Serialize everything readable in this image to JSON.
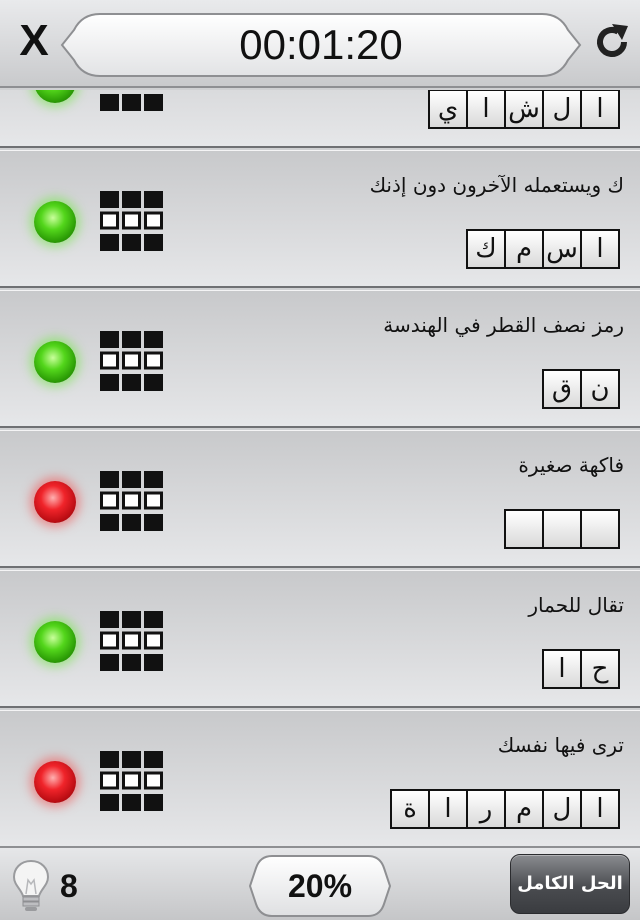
{
  "header": {
    "close_label": "X",
    "timer": "00:01:20"
  },
  "rows": [
    {
      "clue": "",
      "answer": [
        "ا",
        "ل",
        "ش",
        "ا",
        "ي"
      ],
      "status": "green"
    },
    {
      "clue": "ك ويستعمله الآخرون دون إذنك",
      "answer": [
        "ا",
        "س",
        "م",
        "ك"
      ],
      "status": "green"
    },
    {
      "clue": "رمز نصف القطر في الهندسة",
      "answer": [
        "ن",
        "ق"
      ],
      "status": "green"
    },
    {
      "clue": "فاكهة صغيرة",
      "answer": [
        "",
        "",
        ""
      ],
      "status": "red"
    },
    {
      "clue": "تقال للحمار",
      "answer": [
        "ح",
        "ا"
      ],
      "status": "green"
    },
    {
      "clue": "ترى فيها نفسك",
      "answer": [
        "ا",
        "ل",
        "م",
        "ر",
        "ا",
        "ة"
      ],
      "status": "red"
    }
  ],
  "footer": {
    "hint_count": "8",
    "progress": "20%",
    "solve_label": "الحل الكامل"
  },
  "colors": {
    "status_green": "#53d61b",
    "status_red": "#f0242a"
  },
  "icons": {
    "close": "close-icon",
    "refresh": "refresh-icon",
    "status": "status-light-icon",
    "grid": "grid-icon",
    "hint": "lightbulb-icon"
  }
}
